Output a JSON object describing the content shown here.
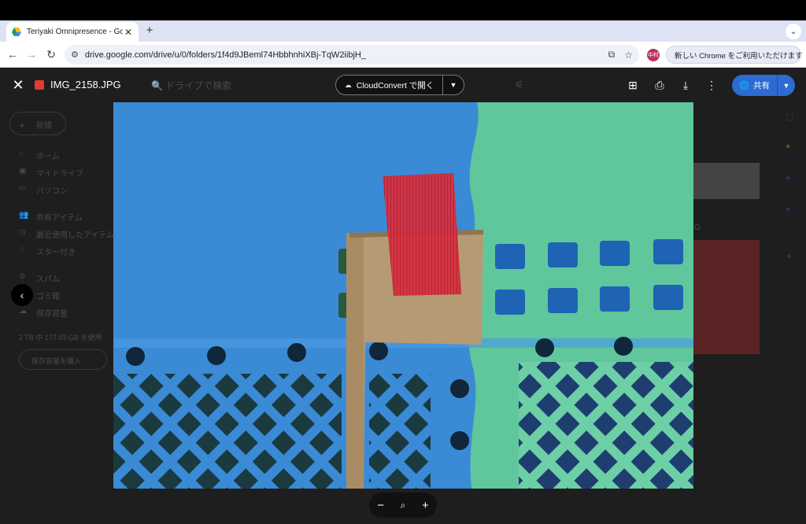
{
  "browser": {
    "tab_title": "Teriyaki Omnipresence - Goo",
    "tab_close": "✕",
    "new_tab": "+",
    "tab_menu": "⌄",
    "url": "drive.google.com/drive/u/0/folders/1f4d9JBeml74HbbhnhiXBj-TqW2iibjH_",
    "profile_label": "中村",
    "update_label": "新しい Chrome をご利用いただけます",
    "update_menu": "⋮"
  },
  "drive_background": {
    "new_button": "新規",
    "search_placeholder": "ドライブで検索",
    "nav": [
      {
        "icon": "⌂",
        "label": "ホーム"
      },
      {
        "icon": "▣",
        "label": "マイドライブ"
      },
      {
        "icon": "▭",
        "label": "パソコン"
      },
      {
        "icon": "👥",
        "label": "共有アイテム"
      },
      {
        "icon": "◷",
        "label": "最近使用したアイテム"
      },
      {
        "icon": "☆",
        "label": "スター付き"
      },
      {
        "icon": "⊘",
        "label": "スパム"
      },
      {
        "icon": "🗑",
        "label": "ゴミ箱"
      },
      {
        "icon": "☁",
        "label": "保存容量"
      }
    ],
    "storage_text": "2 TB 中 177.93 GB を使用",
    "storage_button": "保存容量を購入",
    "right_label": "G"
  },
  "viewer": {
    "file_name": "IMG_2158.JPG",
    "open_with_label": "CloudConvert で開く",
    "share_label": "共有",
    "icons": {
      "close": "close-icon",
      "add_shortcut": "add-to-drive-icon",
      "print": "print-icon",
      "download": "download-icon",
      "more": "more-vert-icon"
    }
  },
  "zoom": {
    "minus": "−",
    "magnifier": "🔍",
    "plus": "+"
  },
  "colors": {
    "share_blue": "#2c6bd1",
    "tape_red": "#d63040",
    "crate_blue": "#3a8ad6",
    "crate_green": "#5fc79b",
    "cardboard": "#b59a73"
  }
}
